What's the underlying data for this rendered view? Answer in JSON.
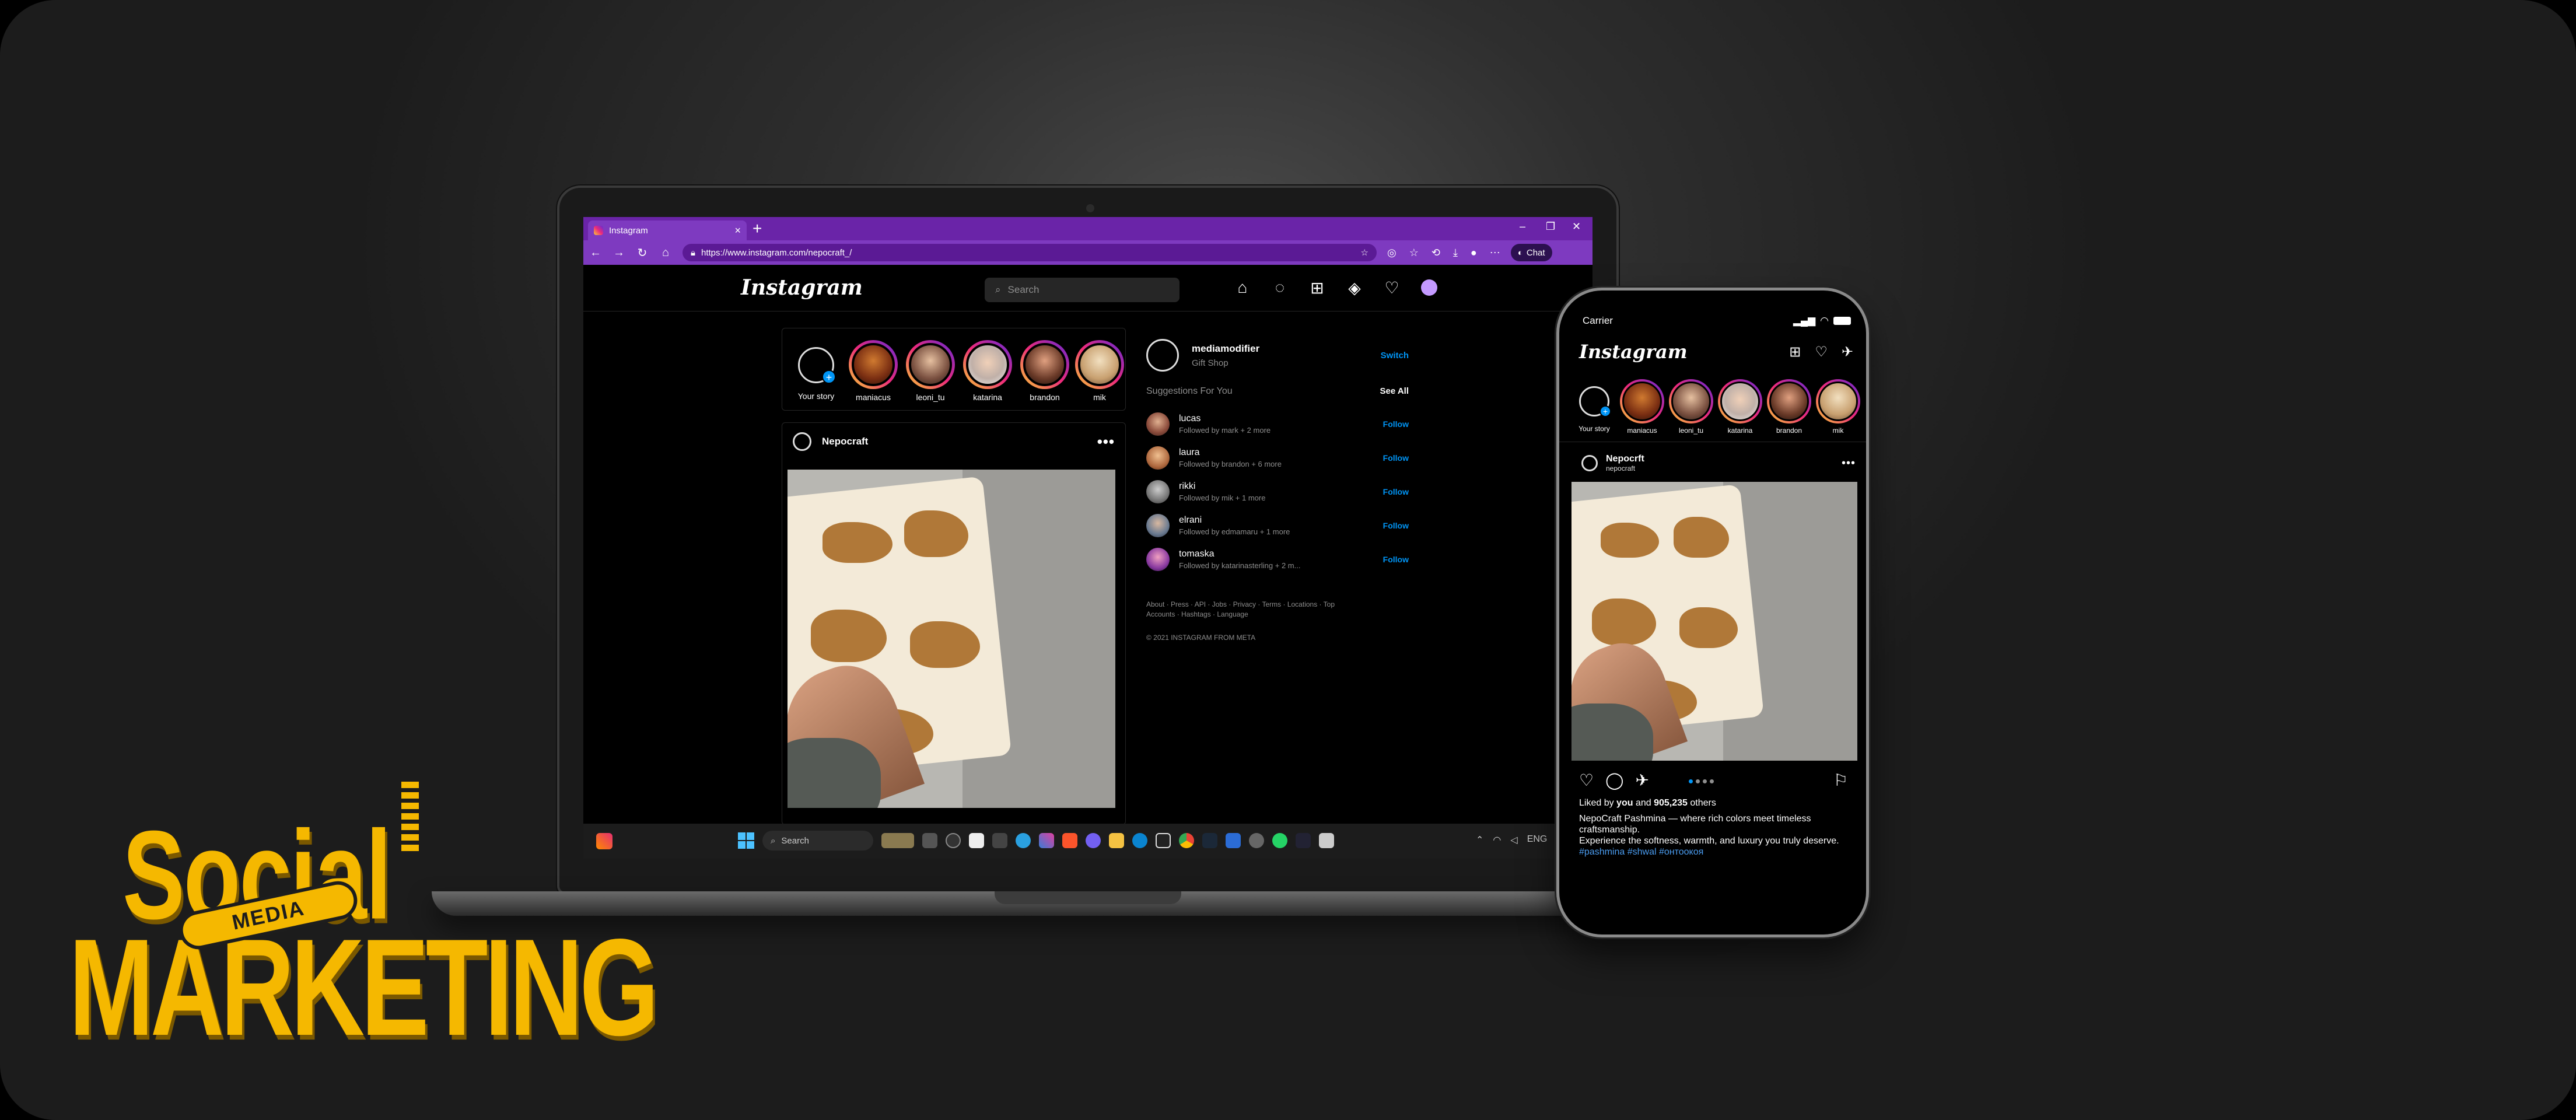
{
  "browser": {
    "tab_title": "Instagram",
    "new_tab": "+",
    "url": "https://www.instagram.com/nepocraft_/",
    "chat_label": "Chat",
    "window_controls": [
      "minimize-icon",
      "restore-icon",
      "close-icon"
    ]
  },
  "instagram_desktop": {
    "logo": "Instagram",
    "search_placeholder": "Search",
    "nav_icons": [
      "home-icon",
      "messenger-icon",
      "new-post-icon",
      "explore-icon",
      "heart-icon",
      "profile-avatar"
    ],
    "stories": [
      {
        "name": "Your story",
        "own": true
      },
      {
        "name": "maniacus"
      },
      {
        "name": "leoni_tu"
      },
      {
        "name": "katarina"
      },
      {
        "name": "brandon"
      },
      {
        "name": "mik"
      }
    ],
    "post": {
      "author": "Nepocraft",
      "menu": "•••"
    },
    "profile": {
      "username": "mediamodifier",
      "subtitle": "Gift Shop",
      "switch_label": "Switch"
    },
    "suggestions_heading": "Suggestions For You",
    "see_all": "See All",
    "suggestions": [
      {
        "name": "lucas",
        "sub": "Followed by mark + 2 more",
        "action": "Follow"
      },
      {
        "name": "laura",
        "sub": "Followed by brandon + 6 more",
        "action": "Follow"
      },
      {
        "name": "rikki",
        "sub": "Followed by mik + 1 more",
        "action": "Follow"
      },
      {
        "name": "elrani",
        "sub": "Followed by edmamaru + 1 more",
        "action": "Follow"
      },
      {
        "name": "tomaska",
        "sub": "Followed by katarinasterling + 2 m...",
        "action": "Follow"
      }
    ],
    "footer_links": "About · Press · API · Jobs · Privacy · Terms · Locations · Top Accounts · Hashtags · Language",
    "copyright": "© 2021 INSTAGRAM FROM META"
  },
  "taskbar": {
    "search_label": "Search",
    "time_hint": "ENG"
  },
  "instagram_mobile": {
    "carrier": "Carrier",
    "logo": "Instagram",
    "stories": [
      {
        "name": "Your story",
        "own": true
      },
      {
        "name": "maniacus"
      },
      {
        "name": "leoni_tu"
      },
      {
        "name": "katarina"
      },
      {
        "name": "brandon"
      },
      {
        "name": "mik"
      }
    ],
    "post": {
      "author": "Nepocrft",
      "handle": "nepocraft",
      "menu": "•••"
    },
    "likes_prefix": "Liked by ",
    "likes_you": "you",
    "likes_mid": " and ",
    "likes_count": "905,235",
    "likes_suffix": " others",
    "caption_line1": "NepoCraft Pashmina — where rich colors meet timeless craftsmanship.",
    "caption_line2": "Experience the softness, warmth, and luxury you truly deserve.",
    "hashtags": "#pashmina #shwal #онтоокоя"
  },
  "marketing": {
    "social": "Social",
    "media": "MEDIA",
    "marketing": "MARKETING"
  },
  "colors": {
    "browser_purple": "#6a24a8",
    "instagram_blue": "#0095f6",
    "marketing_yellow": "#f5b800"
  }
}
